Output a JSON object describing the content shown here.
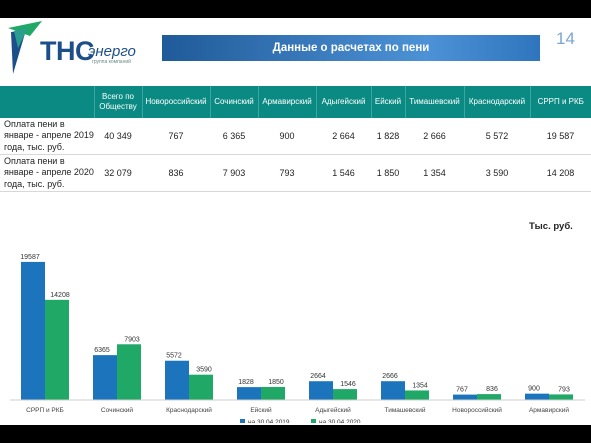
{
  "header": {
    "logo_main": "ТНС",
    "logo_second": "энерго",
    "logo_tagline": "группа компаний",
    "title": "Данные о расчетах по пени",
    "page_number": "14"
  },
  "table": {
    "columns": [
      "",
      "Всего по Обществу",
      "Новороссийский",
      "Сочинский",
      "Армавирский",
      "Адыгейский",
      "Ейский",
      "Тимашевский",
      "Краснодарский",
      "СРРП и РКБ"
    ],
    "rows": [
      {
        "label": "Оплата пени в январе - апреле 2019 года, тыс. руб.",
        "cells": [
          "40 349",
          "767",
          "6 365",
          "900",
          "2 664",
          "1 828",
          "2 666",
          "5 572",
          "19 587"
        ]
      },
      {
        "label": "Оплата пени в январе - апреле 2020 года, тыс. руб.",
        "cells": [
          "32 079",
          "836",
          "7 903",
          "793",
          "1 546",
          "1 850",
          "1 354",
          "3 590",
          "14 208"
        ]
      }
    ]
  },
  "unit_label": "Тыс. руб.",
  "colors": {
    "series_2019": "#1c75bc",
    "series_2020": "#20a866",
    "header_teal": "#0a8a83"
  },
  "chart_data": {
    "type": "bar",
    "title": "",
    "xlabel": "",
    "ylabel": "",
    "ylim": [
      0,
      20000
    ],
    "grid": false,
    "legend": "bottom",
    "categories": [
      "СРРП и РКБ",
      "Сочинский",
      "Краснодарский",
      "Ейский",
      "Адыгейский",
      "Тимашевский",
      "Новороссийский",
      "Армавирский"
    ],
    "series": [
      {
        "name": "на 30.04.2019",
        "values": [
          19587,
          6365,
          5572,
          1828,
          2664,
          2666,
          767,
          900
        ]
      },
      {
        "name": "на 30.04.2020",
        "values": [
          14208,
          7903,
          3590,
          1850,
          1546,
          1354,
          836,
          793
        ]
      }
    ]
  }
}
